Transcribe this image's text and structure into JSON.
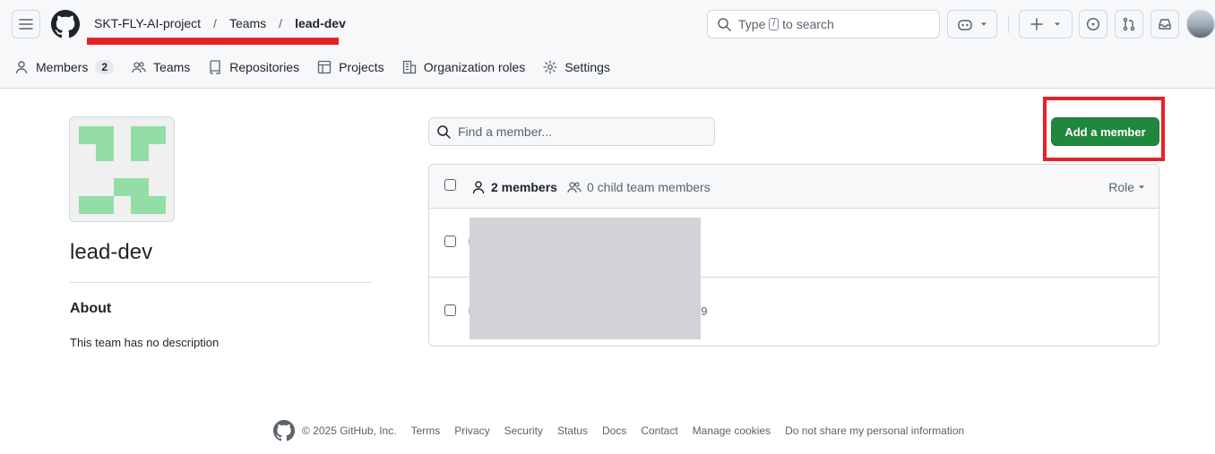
{
  "header": {
    "breadcrumb": [
      "SKT-FLY-AI-project",
      "Teams",
      "lead-dev"
    ],
    "separator": "/",
    "search_text_before": "Type",
    "search_key": "/",
    "search_text_after": "to search"
  },
  "tabs": [
    {
      "label": "Members",
      "count": "2",
      "icon": "person-icon"
    },
    {
      "label": "Teams",
      "icon": "people-icon"
    },
    {
      "label": "Repositories",
      "icon": "repo-icon"
    },
    {
      "label": "Projects",
      "icon": "table-icon"
    },
    {
      "label": "Organization roles",
      "icon": "organization-icon"
    },
    {
      "label": "Settings",
      "icon": "gear-icon"
    }
  ],
  "team": {
    "name": "lead-dev",
    "about_heading": "About",
    "description": "This team has no description"
  },
  "members": {
    "search_placeholder": "Find a member...",
    "add_button": "Add a member",
    "count_label": "2 members",
    "child_label": "0 child team members",
    "role_label": "Role",
    "rows": [
      {
        "visible_text": ""
      },
      {
        "visible_text": "59"
      }
    ]
  },
  "footer": {
    "copyright": "© 2025 GitHub, Inc.",
    "links": [
      "Terms",
      "Privacy",
      "Security",
      "Status",
      "Docs",
      "Contact",
      "Manage cookies",
      "Do not share my personal information"
    ]
  },
  "colors": {
    "primary_button": "#1f883d",
    "annotation_red": "#e52326",
    "team_avatar_green": "#93dea6"
  }
}
